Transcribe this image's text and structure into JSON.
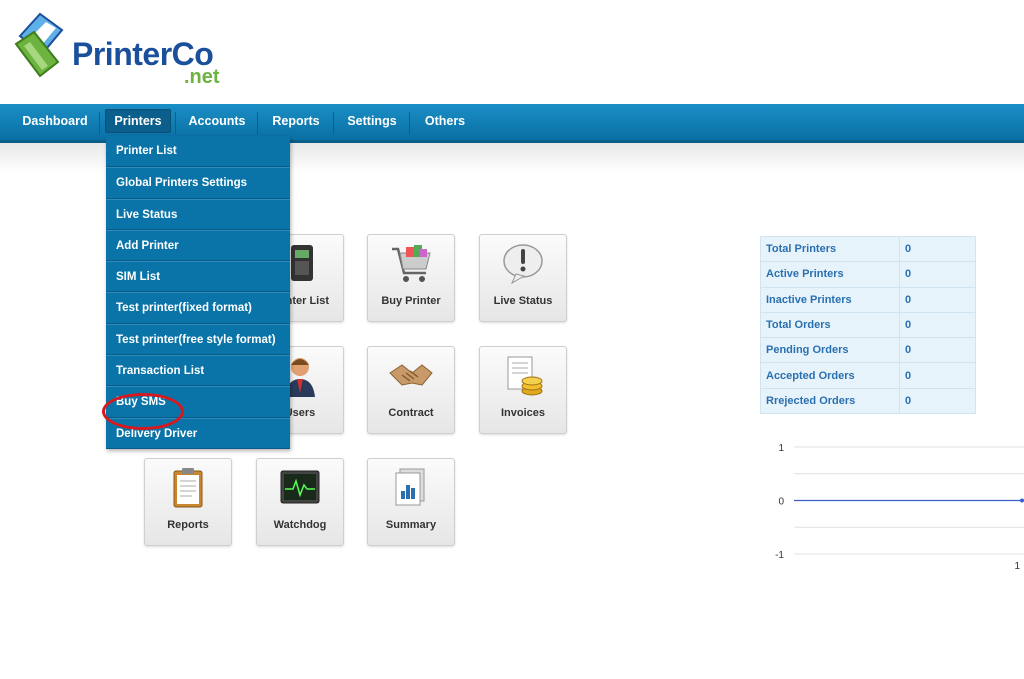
{
  "logo": {
    "name": "Printer",
    "name2": "Co",
    "tld": ".net"
  },
  "nav": {
    "items": [
      {
        "label": "Dashboard"
      },
      {
        "label": "Printers"
      },
      {
        "label": "Accounts"
      },
      {
        "label": "Reports"
      },
      {
        "label": "Settings"
      },
      {
        "label": "Others"
      }
    ]
  },
  "dropdown": {
    "items": [
      {
        "label": "Printer List"
      },
      {
        "label": "Global Printers Settings"
      },
      {
        "label": "Live Status"
      },
      {
        "label": "Add Printer"
      },
      {
        "label": "SIM List"
      },
      {
        "label": "Test printer(fixed format)"
      },
      {
        "label": "Test printer(free style format)"
      },
      {
        "label": "Transaction List"
      },
      {
        "label": "Buy SMS"
      },
      {
        "label": "Delivery Driver"
      }
    ]
  },
  "tiles": {
    "printer_list": "Printer List",
    "buy_printer": "Buy Printer",
    "live_status": "Live Status",
    "users": "Users",
    "contract": "Contract",
    "invoices": "Invoices",
    "reports": "Reports",
    "watchdog": "Watchdog",
    "summary": "Summary"
  },
  "stats": {
    "rows": [
      {
        "label": "Total Printers",
        "value": "0"
      },
      {
        "label": "Active Printers",
        "value": "0"
      },
      {
        "label": "Inactive Printers",
        "value": "0"
      },
      {
        "label": "Total Orders",
        "value": "0"
      },
      {
        "label": "Pending Orders",
        "value": "0"
      },
      {
        "label": "Accepted Orders",
        "value": "0"
      },
      {
        "label": "Rrejected Orders",
        "value": "0"
      }
    ]
  },
  "chart_data": {
    "type": "line",
    "x": [
      1
    ],
    "series": [
      {
        "values": [
          0
        ]
      }
    ],
    "ylim": [
      -1,
      1
    ],
    "yticks": [
      "1",
      "0",
      "-1"
    ],
    "xticks": [
      "1"
    ],
    "grid": true
  },
  "colors": {
    "nav": "#0a74a8",
    "accent": "#1a4f9c",
    "highlight": "#d8181f"
  }
}
